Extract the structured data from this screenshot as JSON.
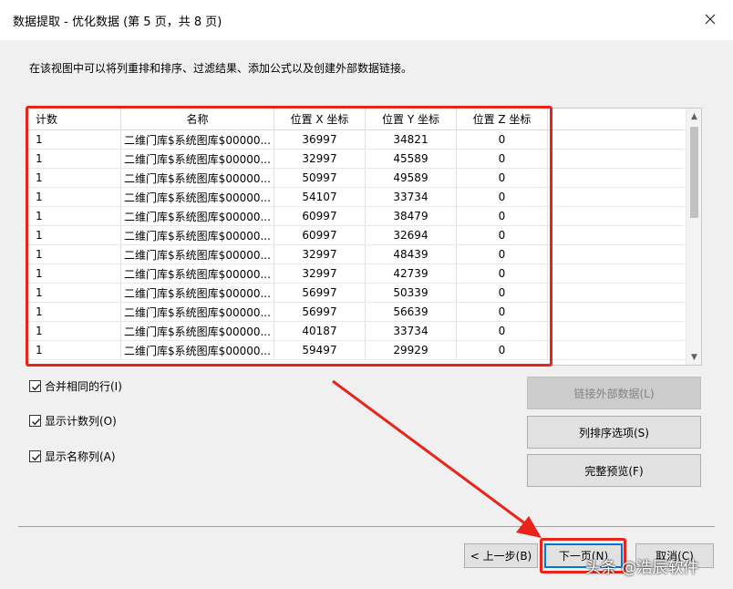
{
  "window": {
    "title": "数据提取 - 优化数据 (第 5 页，共 8 页)",
    "close_icon": "close-icon"
  },
  "description": "在该视图中可以将列重排和排序、过滤结果、添加公式以及创建外部数据链接。",
  "table": {
    "columns": [
      "计数",
      "名称",
      "位置 X 坐标",
      "位置 Y 坐标",
      "位置 Z 坐标"
    ],
    "rows": [
      {
        "count": "1",
        "name": "二维门库$系统图库$00000...",
        "x": "36997",
        "y": "34821",
        "z": "0"
      },
      {
        "count": "1",
        "name": "二维门库$系统图库$00000...",
        "x": "32997",
        "y": "45589",
        "z": "0"
      },
      {
        "count": "1",
        "name": "二维门库$系统图库$00000...",
        "x": "50997",
        "y": "49589",
        "z": "0"
      },
      {
        "count": "1",
        "name": "二维门库$系统图库$00000...",
        "x": "54107",
        "y": "33734",
        "z": "0"
      },
      {
        "count": "1",
        "name": "二维门库$系统图库$00000...",
        "x": "60997",
        "y": "38479",
        "z": "0"
      },
      {
        "count": "1",
        "name": "二维门库$系统图库$00000...",
        "x": "60997",
        "y": "32694",
        "z": "0"
      },
      {
        "count": "1",
        "name": "二维门库$系统图库$00000...",
        "x": "32997",
        "y": "48439",
        "z": "0"
      },
      {
        "count": "1",
        "name": "二维门库$系统图库$00000...",
        "x": "32997",
        "y": "42739",
        "z": "0"
      },
      {
        "count": "1",
        "name": "二维门库$系统图库$00000...",
        "x": "56997",
        "y": "50339",
        "z": "0"
      },
      {
        "count": "1",
        "name": "二维门库$系统图库$00000...",
        "x": "56997",
        "y": "56639",
        "z": "0"
      },
      {
        "count": "1",
        "name": "二维门库$系统图库$00000...",
        "x": "40187",
        "y": "33734",
        "z": "0"
      },
      {
        "count": "1",
        "name": "二维门库$系统图库$00000...",
        "x": "59497",
        "y": "29929",
        "z": "0"
      }
    ]
  },
  "options": {
    "merge_rows": {
      "label": "合并相同的行(I)",
      "checked": true
    },
    "show_count": {
      "label": "显示计数列(O)",
      "checked": true
    },
    "show_name": {
      "label": "显示名称列(A)",
      "checked": true
    }
  },
  "buttons": {
    "link_external": "链接外部数据(L)",
    "column_sort": "列排序选项(S)",
    "full_preview": "完整预览(F)",
    "back": "< 上一步(B)",
    "next": "下一页(N)",
    "cancel": "取消(C)"
  },
  "watermark": "头条 @浩辰软件",
  "colors": {
    "highlight_red": "#e8241b",
    "primary_blue": "#0078d7"
  }
}
